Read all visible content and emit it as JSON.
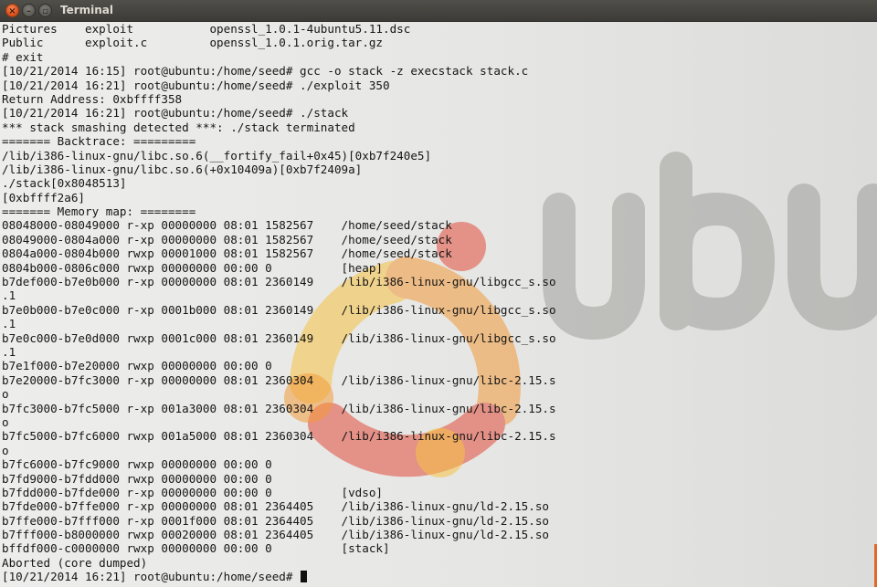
{
  "window": {
    "title": "Terminal",
    "close_glyph": "×",
    "minimize_glyph": "–",
    "maximize_glyph": "▫"
  },
  "colors": {
    "terminal_background": "#ececeb",
    "terminal_text": "#151515",
    "titlebar": "#3c3b37",
    "close_button": "#e0531f",
    "wallpaper_logo_red": "#e24b3b",
    "wallpaper_logo_orange": "#f29a3a",
    "wallpaper_logo_yellow": "#f8c445"
  },
  "terminal": {
    "prompt": "[10/21/2014 16:21] root@ubuntu:/home/seed#",
    "lines": [
      "Pictures    exploit           openssl_1.0.1-4ubuntu5.11.dsc",
      "Public      exploit.c         openssl_1.0.1.orig.tar.gz",
      "# exit",
      "[10/21/2014 16:15] root@ubuntu:/home/seed# gcc -o stack -z execstack stack.c",
      "[10/21/2014 16:21] root@ubuntu:/home/seed# ./exploit 350",
      "Return Address: 0xbffff358",
      "[10/21/2014 16:21] root@ubuntu:/home/seed# ./stack",
      "*** stack smashing detected ***: ./stack terminated",
      "======= Backtrace: =========",
      "/lib/i386-linux-gnu/libc.so.6(__fortify_fail+0x45)[0xb7f240e5]",
      "/lib/i386-linux-gnu/libc.so.6(+0x10409a)[0xb7f2409a]",
      "./stack[0x8048513]",
      "[0xbffff2a6]",
      "======= Memory map: ========",
      "08048000-08049000 r-xp 00000000 08:01 1582567    /home/seed/stack",
      "08049000-0804a000 r-xp 00000000 08:01 1582567    /home/seed/stack",
      "0804a000-0804b000 rwxp 00001000 08:01 1582567    /home/seed/stack",
      "0804b000-0806c000 rwxp 00000000 00:00 0          [heap]",
      "b7def000-b7e0b000 r-xp 00000000 08:01 2360149    /lib/i386-linux-gnu/libgcc_s.so",
      ".1",
      "b7e0b000-b7e0c000 r-xp 0001b000 08:01 2360149    /lib/i386-linux-gnu/libgcc_s.so",
      ".1",
      "b7e0c000-b7e0d000 rwxp 0001c000 08:01 2360149    /lib/i386-linux-gnu/libgcc_s.so",
      ".1",
      "b7e1f000-b7e20000 rwxp 00000000 00:00 0",
      "b7e20000-b7fc3000 r-xp 00000000 08:01 2360304    /lib/i386-linux-gnu/libc-2.15.s",
      "o",
      "b7fc3000-b7fc5000 r-xp 001a3000 08:01 2360304    /lib/i386-linux-gnu/libc-2.15.s",
      "o",
      "b7fc5000-b7fc6000 rwxp 001a5000 08:01 2360304    /lib/i386-linux-gnu/libc-2.15.s",
      "o",
      "b7fc6000-b7fc9000 rwxp 00000000 00:00 0",
      "b7fd9000-b7fdd000 rwxp 00000000 00:00 0",
      "b7fdd000-b7fde000 r-xp 00000000 00:00 0          [vdso]",
      "b7fde000-b7ffe000 r-xp 00000000 08:01 2364405    /lib/i386-linux-gnu/ld-2.15.so",
      "b7ffe000-b7fff000 r-xp 0001f000 08:01 2364405    /lib/i386-linux-gnu/ld-2.15.so",
      "b7fff000-b8000000 rwxp 00020000 08:01 2364405    /lib/i386-linux-gnu/ld-2.15.so",
      "bffdf000-c0000000 rwxp 00000000 00:00 0          [stack]",
      "Aborted (core dumped)"
    ]
  }
}
